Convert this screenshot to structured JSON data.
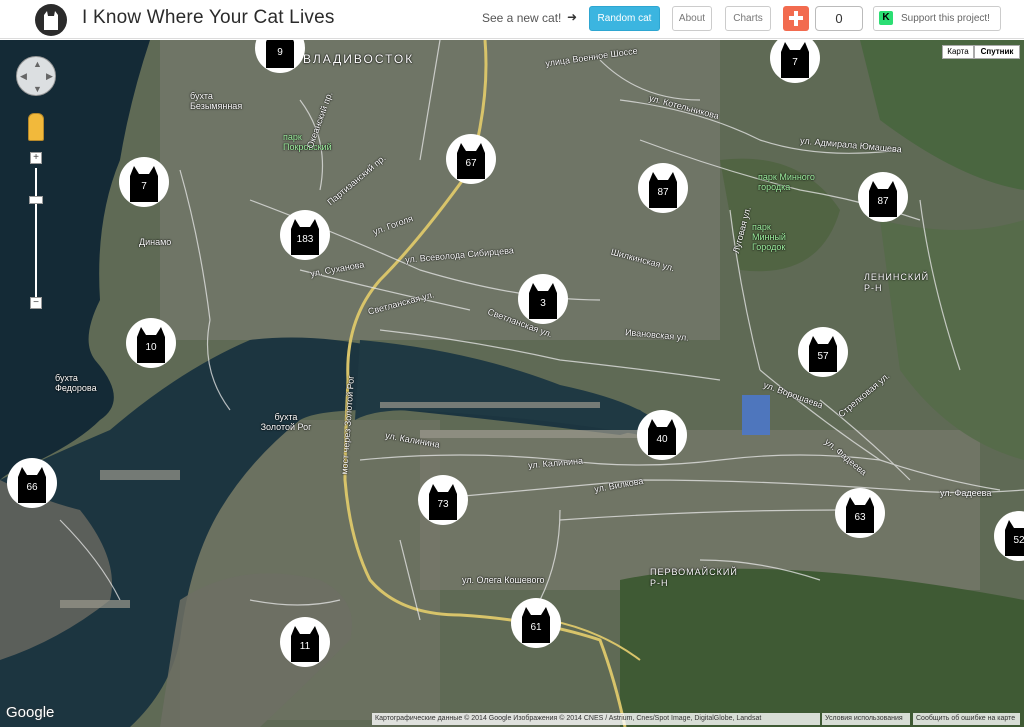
{
  "header": {
    "title": "I Know Where Your Cat Lives",
    "see_new_cat": "See a new cat!",
    "arrow_glyph": "➜",
    "random_cat": "Random cat",
    "about": "About",
    "charts": "Charts",
    "share_count": "0",
    "support": "Support this project!",
    "support_icon_letter": "K"
  },
  "map": {
    "type_map": "Карта",
    "type_satellite": "Спутник",
    "zoom_in": "+",
    "zoom_out": "−",
    "google": "Google",
    "attribution_data": "Картографические данные © 2014 Google Изображения © 2014 CNES / Astrium, Cnes/Spot Image, DigitalGlobe, Landsat",
    "attribution_terms": "Условия использования",
    "attribution_report": "Сообщить об ошибке на карте",
    "markers": [
      {
        "id": "m-9",
        "count": "9"
      },
      {
        "id": "m-7-top",
        "count": "7"
      },
      {
        "id": "m-7-left",
        "count": "7"
      },
      {
        "id": "m-67",
        "count": "67"
      },
      {
        "id": "m-87-a",
        "count": "87"
      },
      {
        "id": "m-87-b",
        "count": "87"
      },
      {
        "id": "m-183",
        "count": "183"
      },
      {
        "id": "m-3",
        "count": "3"
      },
      {
        "id": "m-10",
        "count": "10"
      },
      {
        "id": "m-57",
        "count": "57"
      },
      {
        "id": "m-40",
        "count": "40"
      },
      {
        "id": "m-66",
        "count": "66"
      },
      {
        "id": "m-73",
        "count": "73"
      },
      {
        "id": "m-63",
        "count": "63"
      },
      {
        "id": "m-52",
        "count": "52"
      },
      {
        "id": "m-61",
        "count": "61"
      },
      {
        "id": "m-11",
        "count": "11"
      }
    ],
    "labels": {
      "vladivostok": "ВЛАДИВОСТОК",
      "bukhta_bezymyannaya": "бухта Безымянная",
      "park_pokrovsky": "парк Покровский",
      "partizansky": "Партизанский пр.",
      "okeansky": "Океанский пр.",
      "dinamo": "Динамо",
      "ul_suhanova": "ул. Суханова",
      "ul_vsevoloda": "ул. Всеволода Сибирцева",
      "ul_gogolya": "ул. Гоголя",
      "ul_voennoe_shosse": "улица Военное Шоссе",
      "ul_kotelnikova": "ул. Котельникова",
      "ul_admirala": "ул. Адмирала Юмашева",
      "park_minnogo": "парк Минного городка",
      "park_minny": "парк Минный Городок",
      "leninsky": "ЛЕНИНСКИЙ Р-Н",
      "svetlanskaya_1": "Светланская ул.",
      "svetlanskaya_2": "Светланская ул.",
      "ivanovskaya": "Ивановская ул.",
      "bukhta_fedorova": "бухта Федорова",
      "bukhta_zolotoy": "бухта Золотой Рог",
      "most": "мост через Золотой Рог",
      "ul_kalinina_1": "ул. Калинина",
      "ul_kalinina_2": "ул. Калинина",
      "ul_vilkova": "ул. Вилкова",
      "ul_voroplaeva": "ул. Ворошаева",
      "ul_fadeeva": "ул. Фадеева",
      "ul_fadeeva_2": "ул. Фадеева",
      "pervomaysky": "ПЕРВОМАЙСКИЙ Р-Н",
      "ul_olega": "ул. Олега Кошевого",
      "shilinskaya": "Шилкинская ул.",
      "lugovaya": "Луговая ул.",
      "streletskaya": "Стрелковая ул."
    }
  }
}
